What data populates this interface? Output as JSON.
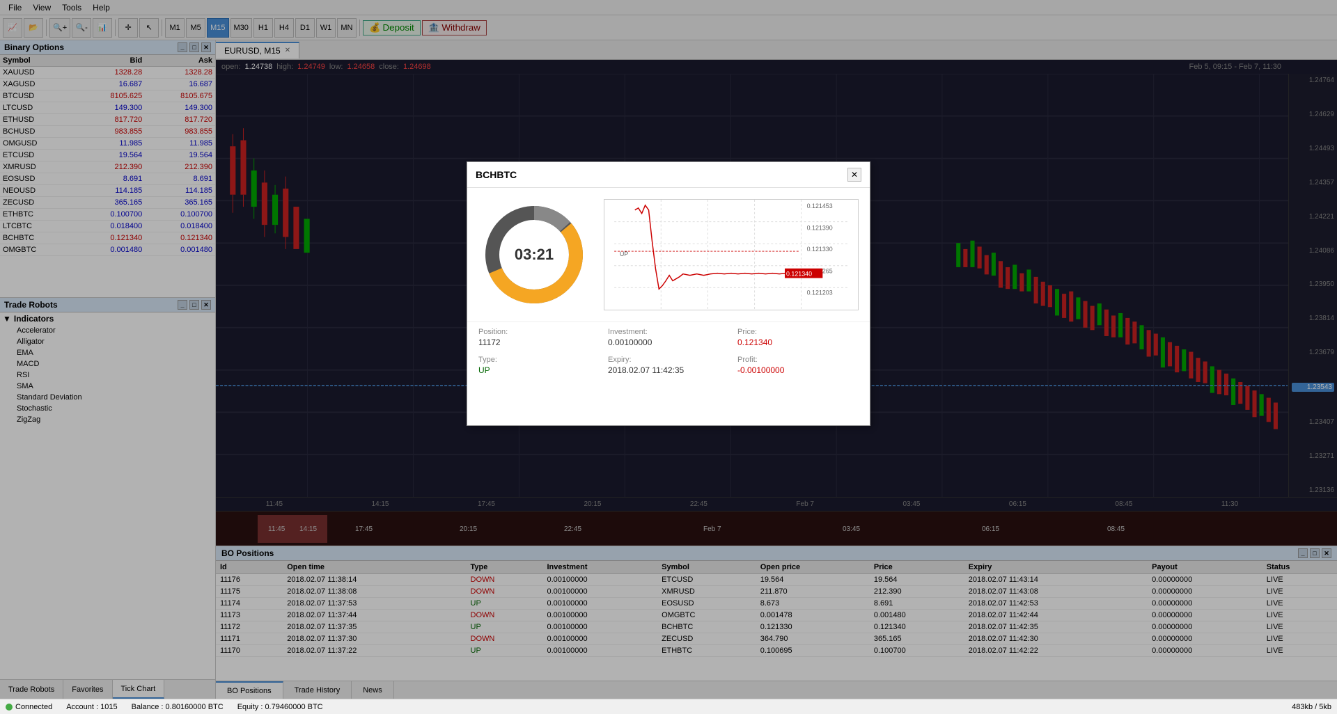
{
  "menu": {
    "items": [
      "File",
      "View",
      "Tools",
      "Help"
    ]
  },
  "toolbar": {
    "timeframes": [
      "M1",
      "M5",
      "M15",
      "M30",
      "H1",
      "H4",
      "D1",
      "W1",
      "MN"
    ],
    "active_timeframe": "M15",
    "deposit_label": "Deposit",
    "withdraw_label": "Withdraw"
  },
  "binary_options": {
    "title": "Binary Options",
    "columns": [
      "Symbol",
      "Bid",
      "Ask"
    ],
    "symbols": [
      {
        "name": "XAUUSD",
        "bid": "1328.28",
        "ask": "1328.28",
        "color": "red"
      },
      {
        "name": "XAGUSD",
        "bid": "16.687",
        "ask": "16.687",
        "color": "blue"
      },
      {
        "name": "BTCUSD",
        "bid": "8105.625",
        "ask": "8105.675",
        "color": "red"
      },
      {
        "name": "LTCUSD",
        "bid": "149.300",
        "ask": "149.300",
        "color": "blue"
      },
      {
        "name": "ETHUSD",
        "bid": "817.720",
        "ask": "817.720",
        "color": "red"
      },
      {
        "name": "BCHUSD",
        "bid": "983.855",
        "ask": "983.855",
        "color": "red"
      },
      {
        "name": "OMGUSD",
        "bid": "11.985",
        "ask": "11.985",
        "color": "blue"
      },
      {
        "name": "ETCUSD",
        "bid": "19.564",
        "ask": "19.564",
        "color": "blue"
      },
      {
        "name": "XMRUSD",
        "bid": "212.390",
        "ask": "212.390",
        "color": "red"
      },
      {
        "name": "EOSUSD",
        "bid": "8.691",
        "ask": "8.691",
        "color": "blue"
      },
      {
        "name": "NEOUSD",
        "bid": "114.185",
        "ask": "114.185",
        "color": "blue"
      },
      {
        "name": "ZECUSD",
        "bid": "365.165",
        "ask": "365.165",
        "color": "blue"
      },
      {
        "name": "ETHBTC",
        "bid": "0.100700",
        "ask": "0.100700",
        "color": "blue"
      },
      {
        "name": "LTCBTC",
        "bid": "0.018400",
        "ask": "0.018400",
        "color": "blue"
      },
      {
        "name": "BCHBTC",
        "bid": "0.121340",
        "ask": "0.121340",
        "color": "red"
      },
      {
        "name": "OMGBTC",
        "bid": "0.001480",
        "ask": "0.001480",
        "color": "blue"
      }
    ]
  },
  "trade_robots": {
    "title": "Trade Robots",
    "indicators_label": "Indicators",
    "indicators": [
      "Accelerator",
      "Alligator",
      "EMA",
      "MACD",
      "RSI",
      "SMA",
      "Standard Deviation",
      "Stochastic",
      "ZigZag"
    ]
  },
  "left_tabs": [
    "Trade Robots",
    "Favorites",
    "Tick Chart"
  ],
  "chart": {
    "tab_title": "EURUSD, M15",
    "ohlc": {
      "open_label": "open:",
      "open_value": "1.24738",
      "high_label": "high:",
      "high_value": "1.24749",
      "low_label": "low:",
      "low_value": "1.24658",
      "close_label": "close:",
      "close_value": "1.24698"
    },
    "date_range": "Feb 5, 09:15 - Feb 7, 11:30",
    "price_levels": [
      "1.24764",
      "1.24629",
      "1.24493",
      "1.24357",
      "1.24221",
      "1.24086",
      "1.23950",
      "1.23814",
      "1.23679",
      "1.23543",
      "1.23407",
      "1.23271",
      "1.23136"
    ],
    "current_price": "1.23543",
    "time_labels": [
      "11:45",
      "14:15",
      "17:45",
      "20:15",
      "22:45",
      "Feb 7",
      "03:45",
      "06:15",
      "08:45",
      "11:30"
    ]
  },
  "modal": {
    "title": "BCHBTC",
    "timer": "03:21",
    "chart_prices": [
      "0.121453",
      "0.121390",
      "0.121330",
      "0.121265",
      "0.121203"
    ],
    "current_marker": "0.121340",
    "up_marker": "UP",
    "position": "11172",
    "type": "UP",
    "investment": "0.00100000",
    "expiry": "2018.02.07 11:42:35",
    "price": "0.121340",
    "profit": "-0.00100000",
    "labels": {
      "position": "Position:",
      "type": "Type:",
      "investment": "Investment:",
      "expiry": "Expiry:",
      "price": "Price:",
      "profit": "Profit:"
    }
  },
  "bo_positions": {
    "title": "BO Positions",
    "columns": [
      "Id",
      "Open time",
      "Type",
      "Investment",
      "Symbol",
      "Open price",
      "Price",
      "Expiry",
      "Payout",
      "Status"
    ],
    "rows": [
      {
        "id": "11176",
        "open_time": "2018.02.07 11:38:14",
        "type": "DOWN",
        "investment": "0.00100000",
        "symbol": "ETCUSD",
        "open_price": "19.564",
        "price": "19.564",
        "expiry": "2018.02.07 11:43:14",
        "payout": "0.00000000",
        "status": "LIVE"
      },
      {
        "id": "11175",
        "open_time": "2018.02.07 11:38:08",
        "type": "DOWN",
        "investment": "0.00100000",
        "symbol": "XMRUSD",
        "open_price": "211.870",
        "price": "212.390",
        "expiry": "2018.02.07 11:43:08",
        "payout": "0.00000000",
        "status": "LIVE"
      },
      {
        "id": "11174",
        "open_time": "2018.02.07 11:37:53",
        "type": "UP",
        "investment": "0.00100000",
        "symbol": "EOSUSD",
        "open_price": "8.673",
        "price": "8.691",
        "expiry": "2018.02.07 11:42:53",
        "payout": "0.00000000",
        "status": "LIVE"
      },
      {
        "id": "11173",
        "open_time": "2018.02.07 11:37:44",
        "type": "DOWN",
        "investment": "0.00100000",
        "symbol": "OMGBTC",
        "open_price": "0.001478",
        "price": "0.001480",
        "expiry": "2018.02.07 11:42:44",
        "payout": "0.00000000",
        "status": "LIVE"
      },
      {
        "id": "11172",
        "open_time": "2018.02.07 11:37:35",
        "type": "UP",
        "investment": "0.00100000",
        "symbol": "BCHBTC",
        "open_price": "0.121330",
        "price": "0.121340",
        "expiry": "2018.02.07 11:42:35",
        "payout": "0.00000000",
        "status": "LIVE"
      },
      {
        "id": "11171",
        "open_time": "2018.02.07 11:37:30",
        "type": "DOWN",
        "investment": "0.00100000",
        "symbol": "ZECUSD",
        "open_price": "364.790",
        "price": "365.165",
        "expiry": "2018.02.07 11:42:30",
        "payout": "0.00000000",
        "status": "LIVE"
      },
      {
        "id": "11170",
        "open_time": "2018.02.07 11:37:22",
        "type": "UP",
        "investment": "0.00100000",
        "symbol": "ETHBTC",
        "open_price": "0.100695",
        "price": "0.100700",
        "expiry": "2018.02.07 11:42:22",
        "payout": "0.00000000",
        "status": "LIVE"
      }
    ]
  },
  "bottom_tabs": [
    "BO Positions",
    "Trade History",
    "News"
  ],
  "status_bar": {
    "connected": "Connected",
    "account_label": "Account : 1015",
    "balance_label": "Balance : 0.80160000 BTC",
    "equity_label": "Equity : 0.79460000 BTC",
    "memory": "483kb / 5kb"
  }
}
